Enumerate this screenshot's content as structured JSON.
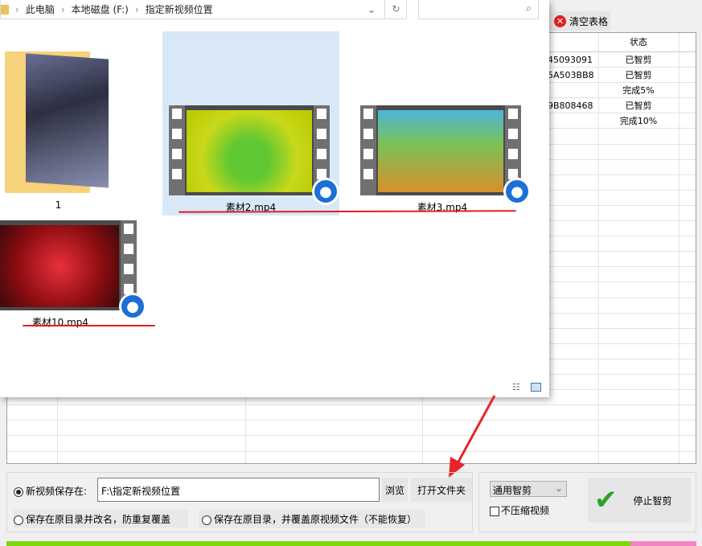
{
  "explorer": {
    "breadcrumb": [
      "此电脑",
      "本地磁盘 (F:)",
      "指定新视频位置"
    ],
    "items": [
      {
        "label": "1",
        "type": "folder"
      },
      {
        "label": "素材2.mp4",
        "type": "video",
        "selected": true
      },
      {
        "label": "素材3.mp4",
        "type": "video"
      },
      {
        "label": "素材10.mp4",
        "type": "video"
      }
    ]
  },
  "toolbar": {
    "clear_label": "清空表格"
  },
  "table": {
    "status_header": "状态",
    "rows": [
      {
        "id": "45093091",
        "status": "已智剪"
      },
      {
        "id": "5A503BB8",
        "status": "已智剪"
      },
      {
        "id": "",
        "status": "完成5%"
      },
      {
        "id": "9B808468",
        "status": "已智剪"
      },
      {
        "id": "",
        "status": "完成10%"
      }
    ]
  },
  "save": {
    "option_new_label": "新视频保存在:",
    "path_value": "F:\\指定新视频位置",
    "browse_label": "浏览",
    "open_folder_label": "打开文件夹",
    "option_rename_label": "保存在原目录并改名，防重复覆盖",
    "option_overwrite_label": "保存在原目录，并覆盖原视频文件（不能恢复）"
  },
  "controls": {
    "mode_selected": "通用智剪",
    "no_compress_label": "不压缩视频",
    "stop_label": "停止智剪"
  },
  "progress": {
    "percent": 90.5
  }
}
